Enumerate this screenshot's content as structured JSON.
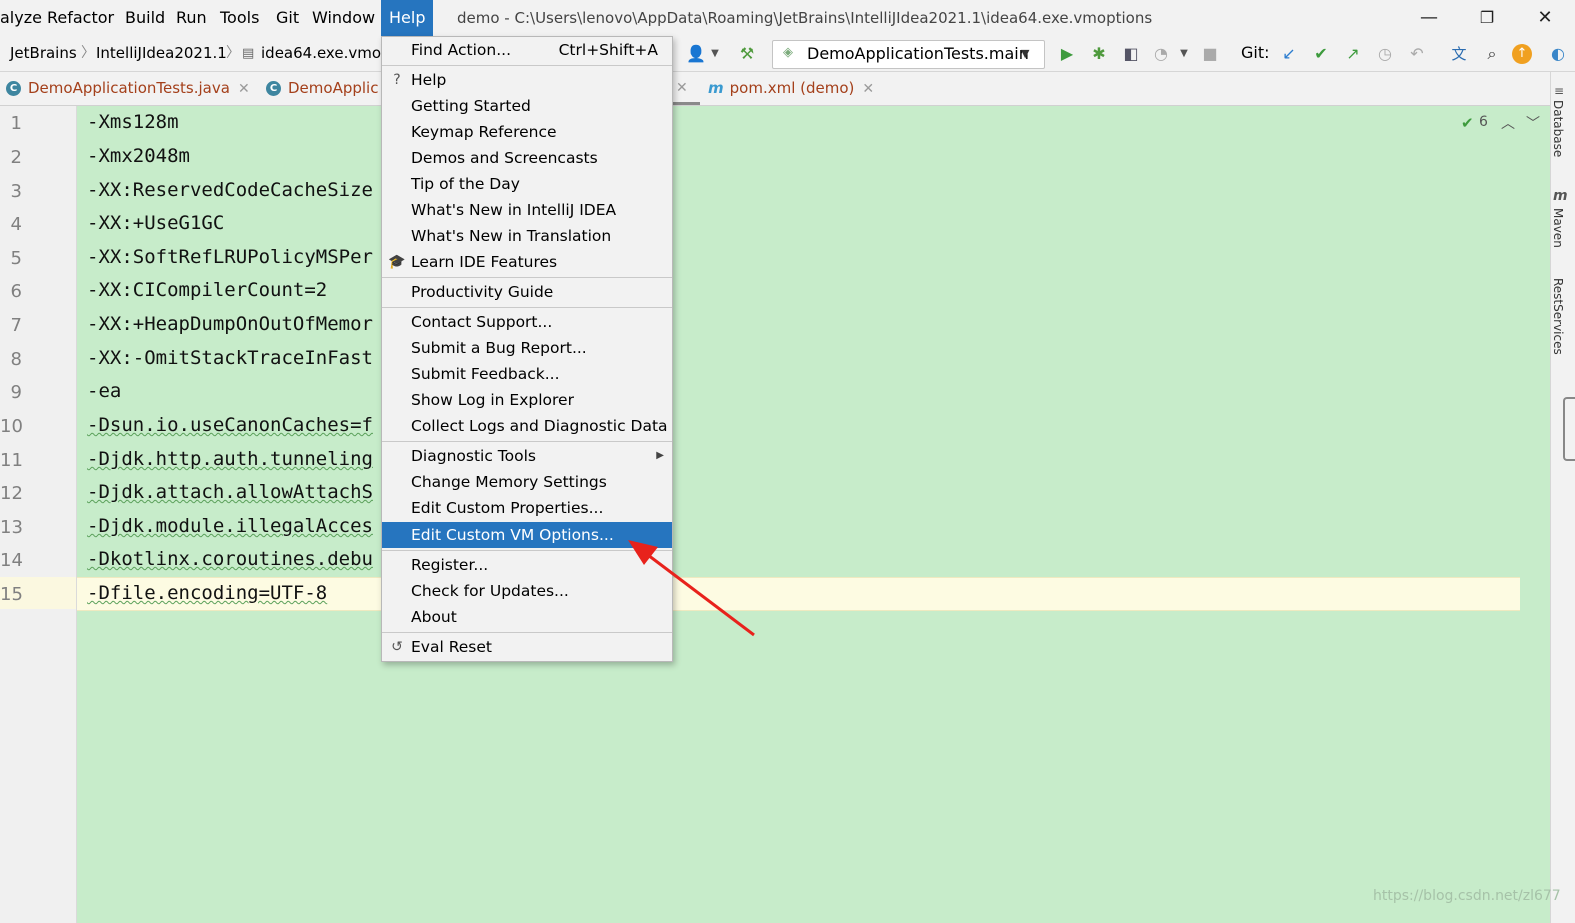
{
  "menubar": {
    "items": [
      "alyze",
      "Refactor",
      "Build",
      "Run",
      "Tools",
      "Git",
      "Window",
      "Help"
    ],
    "title": "demo - C:\\Users\\lenovo\\AppData\\Roaming\\JetBrains\\IntelliJIdea2021.1\\idea64.exe.vmoptions",
    "controls": {
      "minimize": "—",
      "restore": "❐",
      "close": "✕"
    }
  },
  "breadcrumbs": [
    "JetBrains",
    "IntelliJIdea2021.1",
    "idea64.exe.vmop"
  ],
  "toolbar": {
    "run_config": "DemoApplicationTests.main",
    "git_label": "Git:"
  },
  "tabs": [
    {
      "label": "DemoApplicationTests.java",
      "close": "✕"
    },
    {
      "label": "DemoApplic"
    },
    {
      "label": "pom.xml (demo)",
      "close": "✕"
    }
  ],
  "editor": {
    "inspection_count": "6",
    "lines": [
      {
        "n": "1",
        "text": "-Xms128m"
      },
      {
        "n": "2",
        "text": "-Xmx2048m"
      },
      {
        "n": "3",
        "text": "-XX:ReservedCodeCacheSize"
      },
      {
        "n": "4",
        "text": "-XX:+UseG1GC"
      },
      {
        "n": "5",
        "text": "-XX:SoftRefLRUPolicyMSPer"
      },
      {
        "n": "6",
        "text": "-XX:CICompilerCount=2"
      },
      {
        "n": "7",
        "text": "-XX:+HeapDumpOnOutOfMemor"
      },
      {
        "n": "8",
        "text": "-XX:-OmitStackTraceInFast"
      },
      {
        "n": "9",
        "text": "-ea"
      },
      {
        "n": "10",
        "text": "-Dsun.io.useCanonCaches=f"
      },
      {
        "n": "11",
        "text": "-Djdk.http.auth.tunneling"
      },
      {
        "n": "12",
        "text": "-Djdk.attach.allowAttachS"
      },
      {
        "n": "13",
        "text": "-Djdk.module.illegalAcces"
      },
      {
        "n": "14",
        "text": "-Dkotlinx.coroutines.debu"
      },
      {
        "n": "15",
        "text": "-Dfile.encoding=UTF-8"
      }
    ]
  },
  "help_menu": {
    "find_action": {
      "label": "Find Action...",
      "shortcut": "Ctrl+Shift+A"
    },
    "group1": [
      "Help",
      "Getting Started",
      "Keymap Reference",
      "Demos and Screencasts",
      "Tip of the Day",
      "What's New in IntelliJ IDEA",
      "What's New in Translation",
      "Learn IDE Features"
    ],
    "group2": [
      "Productivity Guide"
    ],
    "group3": [
      "Contact Support...",
      "Submit a Bug Report...",
      "Submit Feedback...",
      "Show Log in Explorer",
      "Collect Logs and Diagnostic Data"
    ],
    "group4": [
      "Diagnostic Tools",
      "Change Memory Settings",
      "Edit Custom Properties...",
      "Edit Custom VM Options..."
    ],
    "group5": [
      "Register...",
      "Check for Updates...",
      "About"
    ],
    "group6": [
      "Eval Reset"
    ],
    "selected": "Edit Custom VM Options..."
  },
  "right_strip": [
    "Database",
    "Maven",
    "RestServices"
  ],
  "watermark": "https://blog.csdn.net/zl677",
  "colors": {
    "accent": "#2675bf",
    "editor_bg": "#c7ecca",
    "current_line": "#fdfbe2",
    "arrow": "#e8221c"
  }
}
